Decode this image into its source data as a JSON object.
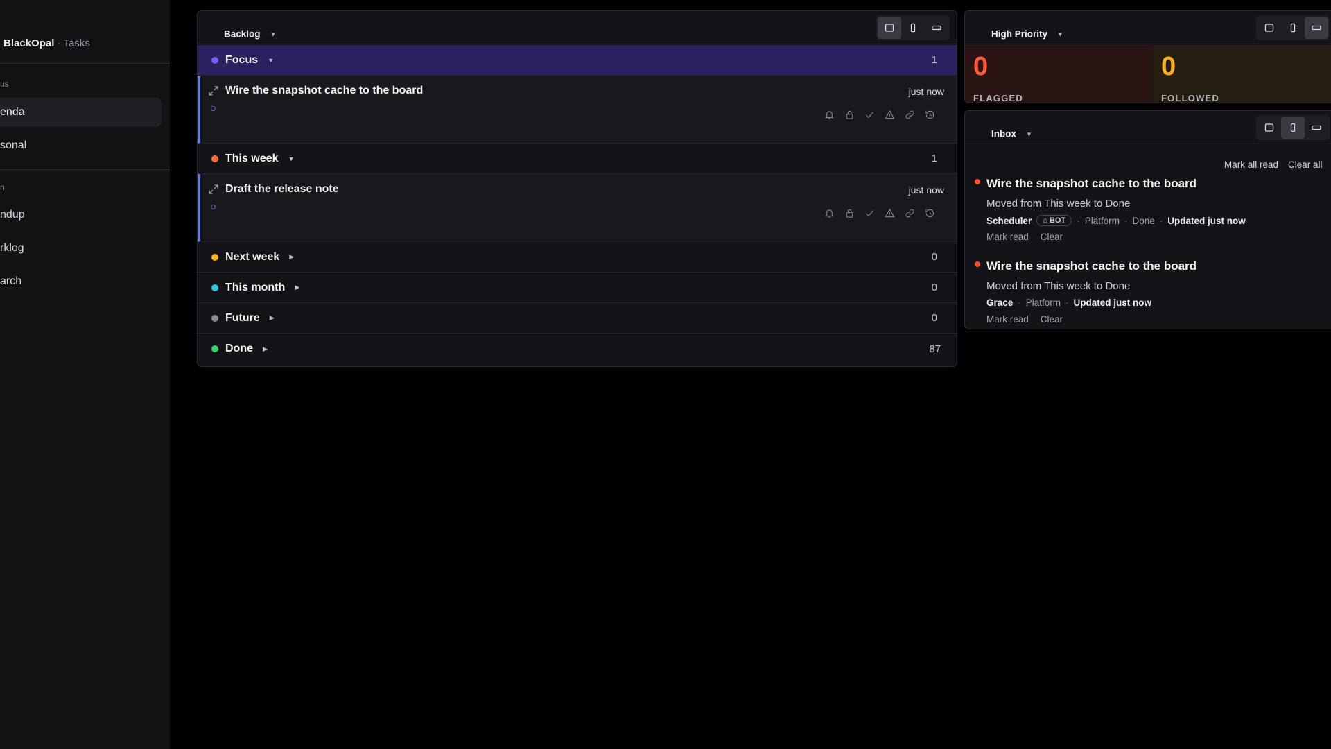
{
  "app": {
    "brand": "BlackOpal",
    "separator": "·",
    "section": "Tasks"
  },
  "sidebar": {
    "sections": [
      {
        "label": "us"
      },
      {
        "label": "n"
      }
    ],
    "items": [
      {
        "label": "enda",
        "active": true
      },
      {
        "label": "sonal",
        "active": false
      },
      {
        "label": "ndup",
        "active": false
      },
      {
        "label": "rklog",
        "active": false
      },
      {
        "label": "arch",
        "active": false
      }
    ]
  },
  "backlog": {
    "title": "Backlog",
    "view": "card",
    "groups": [
      {
        "label": "Focus",
        "count": "1",
        "color": "#7b5cff",
        "expanded": true,
        "tasks": [
          {
            "title": "Wire the snapshot cache to the board",
            "time": "just now"
          }
        ]
      },
      {
        "label": "This week",
        "count": "1",
        "color": "#ff6a3d",
        "expanded": true,
        "tasks": [
          {
            "title": "Draft the release note",
            "time": "just now"
          }
        ]
      },
      {
        "label": "Next week",
        "count": "0",
        "color": "#ffb020",
        "expanded": false
      },
      {
        "label": "This month",
        "count": "0",
        "color": "#2fc6e6",
        "expanded": false
      },
      {
        "label": "Future",
        "count": "0",
        "color": "#8a8a94",
        "expanded": false
      },
      {
        "label": "Done",
        "count": "87",
        "color": "#34d36b",
        "expanded": false
      }
    ],
    "task_action_icons": [
      "bell-icon",
      "lock-icon",
      "check-icon",
      "warning-icon",
      "link-icon",
      "history-icon"
    ]
  },
  "high_priority": {
    "title": "High Priority",
    "view": "row",
    "stats": [
      {
        "value": "0",
        "label": "FLAGGED",
        "color": "#ff5a3c"
      },
      {
        "value": "0",
        "label": "FOLLOWED",
        "color": "#ffb020"
      }
    ]
  },
  "inbox": {
    "title": "Inbox",
    "view": "column",
    "mark_all_read": "Mark all read",
    "clear_all": "Clear all",
    "notifications": [
      {
        "title": "Wire the snapshot cache to the board",
        "description": "Moved from This week to Done",
        "actor": "Scheduler",
        "badge": "BOT",
        "tags": [
          "Platform",
          "Done"
        ],
        "updated": "Updated just now",
        "mark_read": "Mark read",
        "clear": "Clear"
      },
      {
        "title": "Wire the snapshot cache to the board",
        "description": "Moved from This week to Done",
        "actor": "Grace",
        "badge": "",
        "tags": [
          "Platform"
        ],
        "updated": "Updated just now",
        "mark_read": "Mark read",
        "clear": "Clear"
      }
    ]
  }
}
